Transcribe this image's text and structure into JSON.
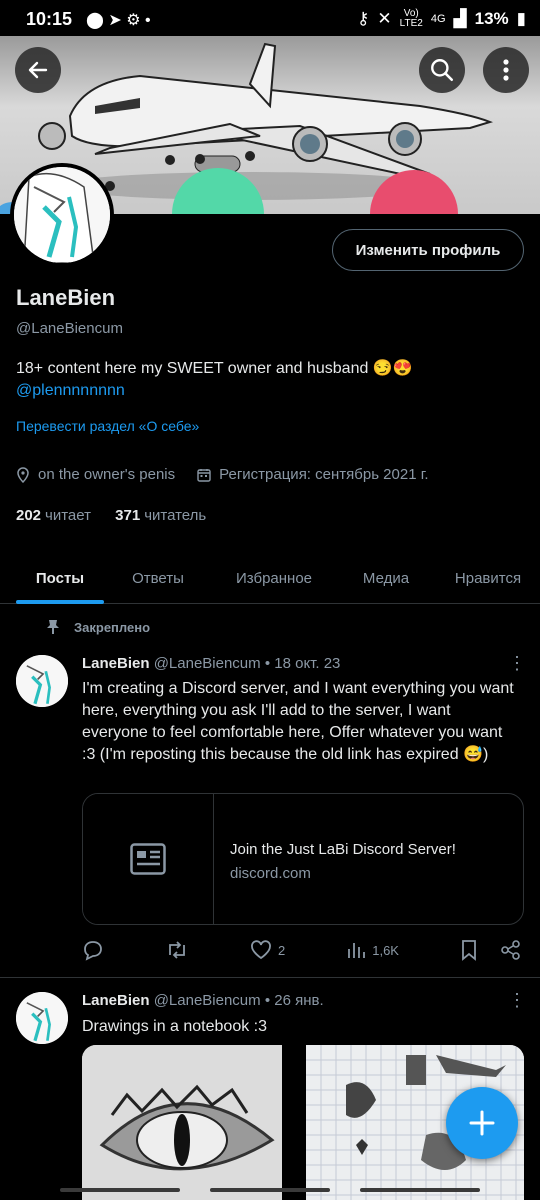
{
  "status": {
    "time": "10:15",
    "battery": "13%",
    "net1": "Vo)",
    "net1b": "LTE2",
    "net2": "4G"
  },
  "profile": {
    "name": "LaneBien",
    "handle": "@LaneBiencum",
    "edit_label": "Изменить профиль",
    "bio_main": "18+ content here my SWEET owner and husband 😏😍",
    "bio_mention": "@plennnnnnnn",
    "translate": "Перевести раздел «О себе»",
    "location": "on the owner's penis",
    "joined": "Регистрация: сентябрь 2021 г.",
    "following_count": "202",
    "following_label": "читает",
    "followers_count": "371",
    "followers_label": "читатель"
  },
  "tabs": [
    "Посты",
    "Ответы",
    "Избранное",
    "Медиа",
    "Нравится"
  ],
  "pinned_label": "Закреплено",
  "posts": [
    {
      "author": "LaneBien",
      "handle": "@LaneBiencum",
      "date": "• 18 окт. 23",
      "text": "I'm creating a Discord server, and I want everything you want here, everything you ask I'll add to the server, I want everyone to feel comfortable here, Offer whatever you want :3 (I'm reposting this because the old link has expired 😅)",
      "card_title": "Join the Just LaBi Discord Server!",
      "card_domain": "discord.com",
      "likes": "2",
      "views": "1,6K"
    },
    {
      "author": "LaneBien",
      "handle": "@LaneBiencum",
      "date": "• 26 янв.",
      "text": "Drawings in a notebook :3"
    }
  ],
  "colors": {
    "accent": "#1d9bf0",
    "bg": "#000000",
    "muted": "#8b98a5"
  }
}
